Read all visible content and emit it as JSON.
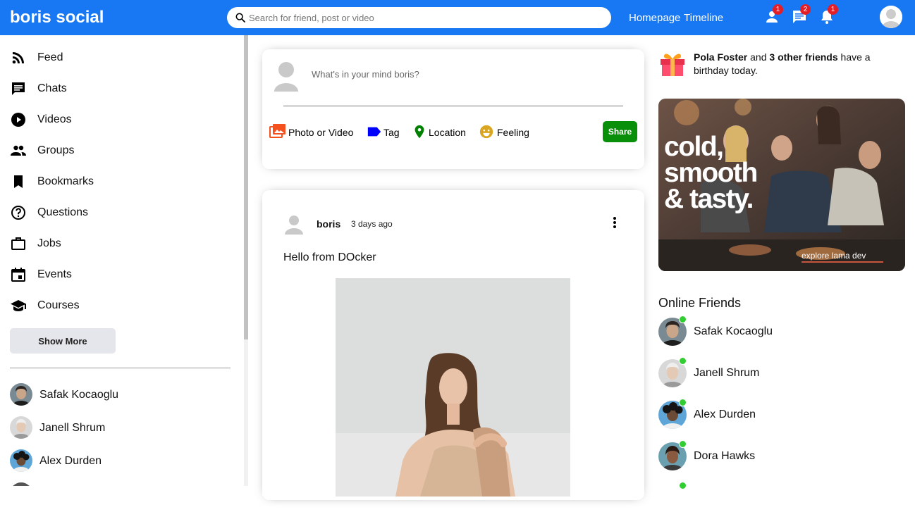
{
  "app": {
    "logo": "boris social"
  },
  "topbar": {
    "search_placeholder": "Search for friend, post or video",
    "links": [
      "Homepage",
      "Timeline"
    ],
    "badges": {
      "friends": "1",
      "chat": "2",
      "notifications": "1"
    }
  },
  "sidebar": {
    "items": [
      {
        "label": "Feed",
        "icon": "rss-icon"
      },
      {
        "label": "Chats",
        "icon": "chat-icon"
      },
      {
        "label": "Videos",
        "icon": "play-circle-icon"
      },
      {
        "label": "Groups",
        "icon": "group-icon"
      },
      {
        "label": "Bookmarks",
        "icon": "bookmark-icon"
      },
      {
        "label": "Questions",
        "icon": "help-circle-icon"
      },
      {
        "label": "Jobs",
        "icon": "briefcase-icon"
      },
      {
        "label": "Events",
        "icon": "calendar-icon"
      },
      {
        "label": "Courses",
        "icon": "school-icon"
      }
    ],
    "show_more": "Show More",
    "friends": [
      "Safak Kocaoglu",
      "Janell Shrum",
      "Alex Durden"
    ]
  },
  "share": {
    "placeholder": "What's in your mind boris?",
    "options": [
      "Photo or Video",
      "Tag",
      "Location",
      "Feeling"
    ],
    "button": "Share",
    "colors": {
      "photo": "#f4511e",
      "tag": "#0000ff",
      "location": "#008000",
      "feeling": "#daa520",
      "share_button": "#0a8f0a"
    }
  },
  "post": {
    "username": "boris",
    "date": "3 days ago",
    "text": "Hello from DOcker"
  },
  "rightbar": {
    "birthday": {
      "name": "Pola Foster",
      "connector": " and ",
      "others": "3 other friends",
      "suffix": " have a birthday today."
    },
    "ad": {
      "title_lines": [
        "cold,",
        "smooth",
        "& tasty."
      ],
      "subtitle": "explore lama dev"
    },
    "online_title": "Online Friends",
    "online_friends": [
      "Safak Kocaoglu",
      "Janell Shrum",
      "Alex Durden",
      "Dora Hawks"
    ]
  },
  "colors": {
    "brand": "#1877f2",
    "badge": "#e41e26",
    "online": "#32cd32"
  }
}
